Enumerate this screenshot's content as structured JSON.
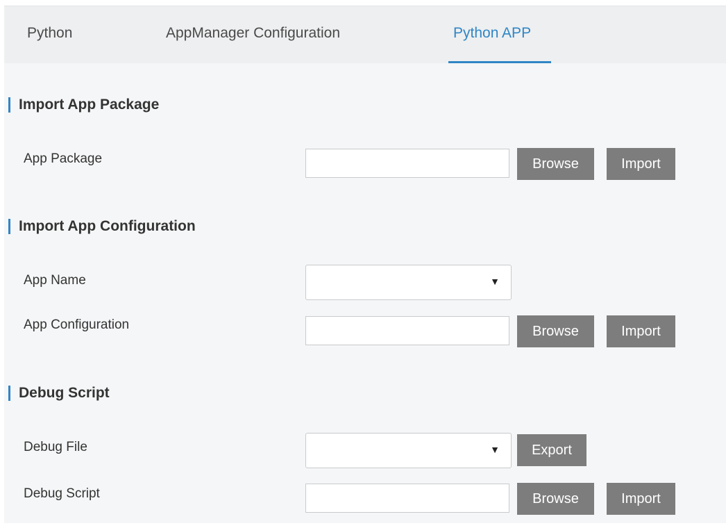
{
  "tabs": [
    {
      "label": "Python"
    },
    {
      "label": "AppManager Configuration"
    },
    {
      "label": "Python APP",
      "active": true
    }
  ],
  "sections": {
    "import_package": {
      "title": "Import App Package",
      "app_package_label": "App Package",
      "app_package_value": "",
      "browse_label": "Browse",
      "import_label": "Import"
    },
    "import_config": {
      "title": "Import App Configuration",
      "app_name_label": "App Name",
      "app_name_value": "",
      "app_config_label": "App Configuration",
      "app_config_value": "",
      "browse_label": "Browse",
      "import_label": "Import"
    },
    "debug": {
      "title": "Debug Script",
      "debug_file_label": "Debug File",
      "debug_file_value": "",
      "export_label": "Export",
      "debug_script_label": "Debug Script",
      "debug_script_value": "",
      "browse_label": "Browse",
      "import_label": "Import"
    }
  },
  "icons": {
    "select_caret": "▼"
  },
  "colors": {
    "accent": "#2f86c6",
    "button_bg": "#7d7d7d",
    "page_bg": "#f5f6f7",
    "tabbar_bg": "#eeeff0"
  }
}
